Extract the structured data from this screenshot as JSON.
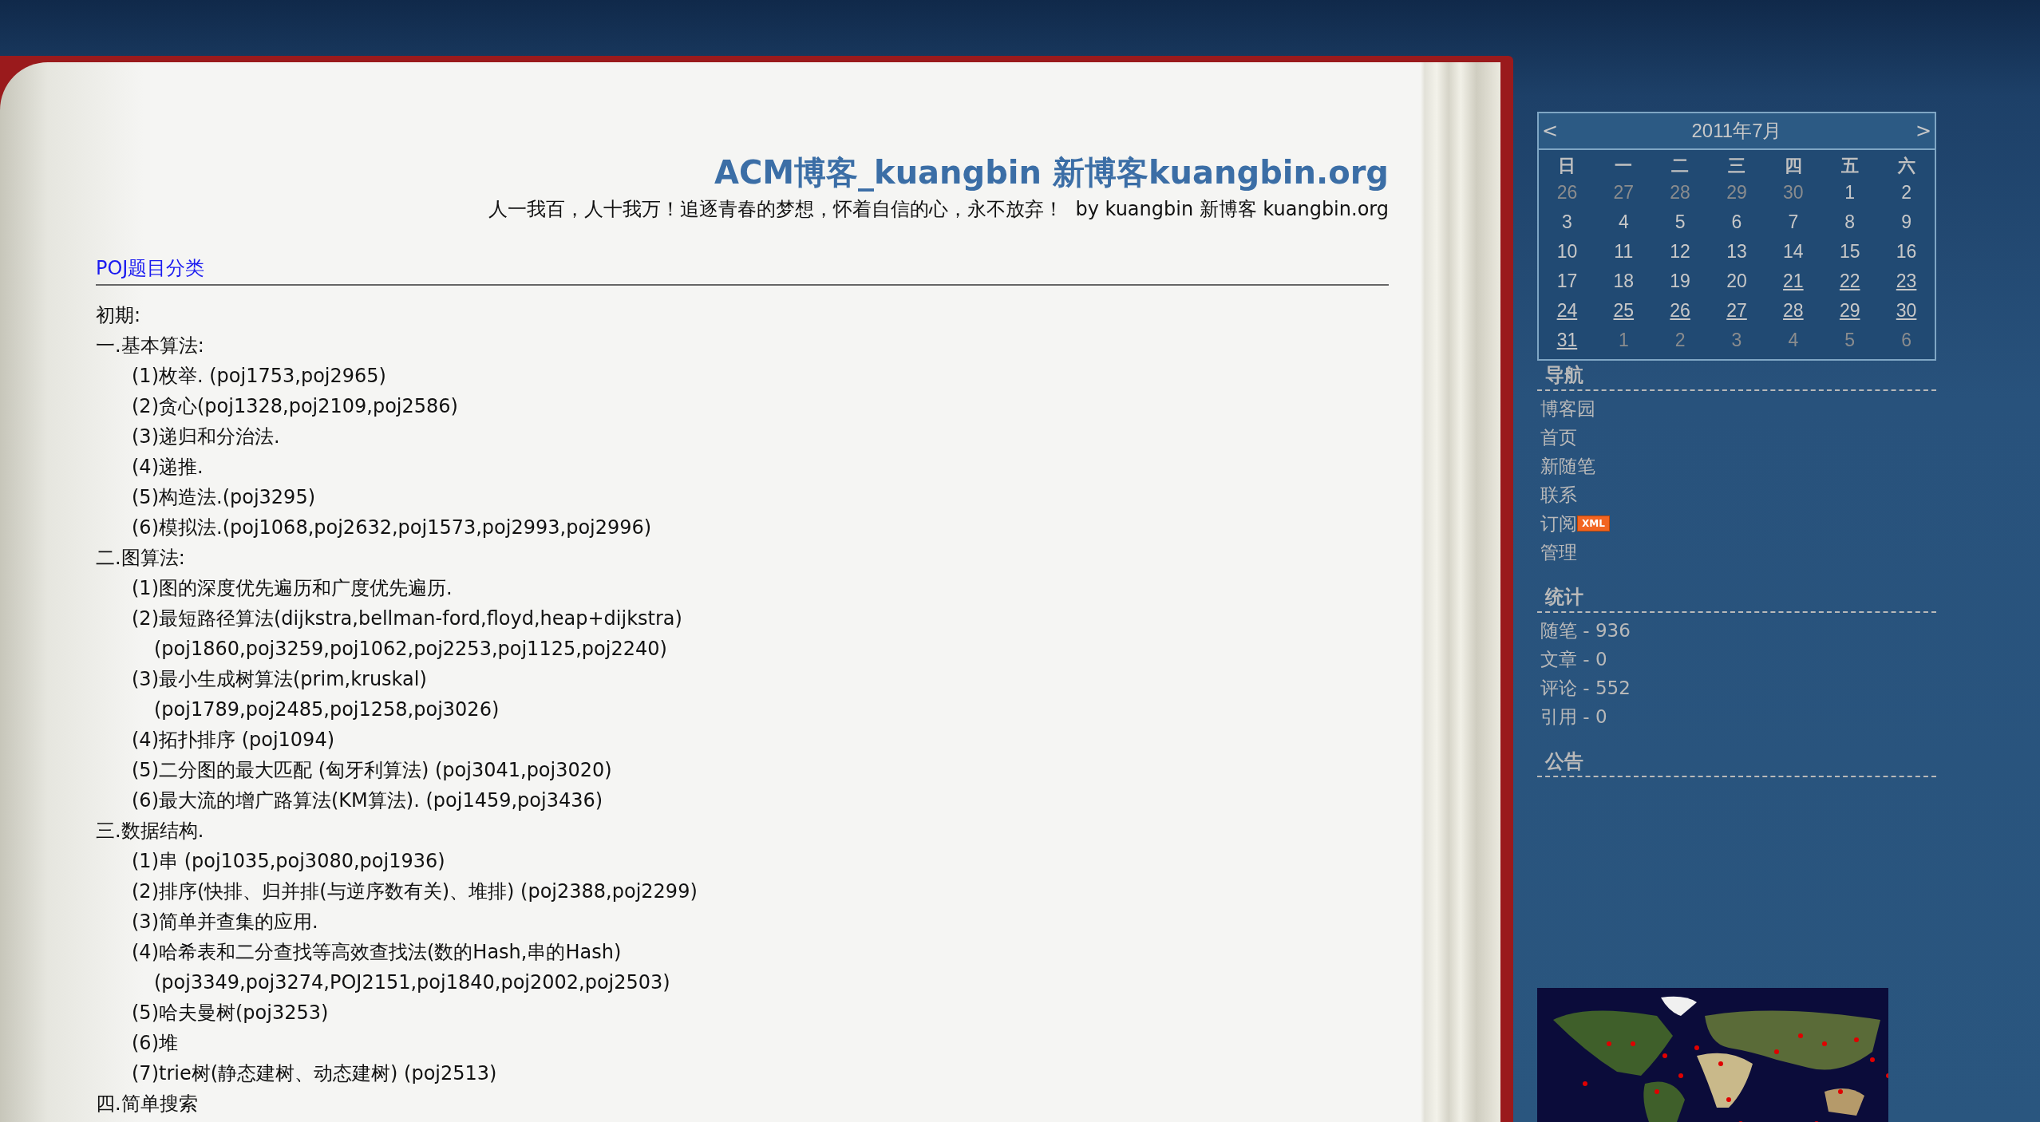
{
  "blog": {
    "title": "ACM博客_kuangbin 新博客kuangbin.org",
    "subtitle": "人一我百，人十我万！追逐青春的梦想，怀着自信的心，永不放弃！  by kuangbin 新博客 kuangbin.org"
  },
  "post": {
    "title": "POJ题目分类",
    "intro": "初期:",
    "categories": [
      {
        "title": "一.基本算法:",
        "children": [
          {
            "text": "(1)枚举. (poj1753,poj2965)"
          },
          {
            "text": "(2)贪心(poj1328,poj2109,poj2586)"
          },
          {
            "text": "(3)递归和分治法."
          },
          {
            "text": "(4)递推."
          },
          {
            "text": "(5)构造法.(poj3295)"
          },
          {
            "text": "(6)模拟法.(poj1068,poj2632,poj1573,poj2993,poj2996)"
          }
        ]
      },
      {
        "title": "二.图算法:",
        "children": [
          {
            "text": "(1)图的深度优先遍历和广度优先遍历."
          },
          {
            "text": "(2)最短路径算法(dijkstra,bellman-ford,floyd,heap+dijkstra)",
            "children": [
              {
                "text": "(poj1860,poj3259,poj1062,poj2253,poj1125,poj2240)"
              }
            ]
          },
          {
            "text": "(3)最小生成树算法(prim,kruskal)",
            "children": [
              {
                "text": "(poj1789,poj2485,poj1258,poj3026)"
              }
            ]
          },
          {
            "text": "(4)拓扑排序 (poj1094)"
          },
          {
            "text": "(5)二分图的最大匹配 (匈牙利算法) (poj3041,poj3020)"
          },
          {
            "text": "(6)最大流的增广路算法(KM算法). (poj1459,poj3436)"
          }
        ]
      },
      {
        "title": "三.数据结构.",
        "children": [
          {
            "text": "(1)串 (poj1035,poj3080,poj1936)"
          },
          {
            "text": "(2)排序(快排、归并排(与逆序数有关)、堆排) (poj2388,poj2299)"
          },
          {
            "text": "(3)简单并查集的应用."
          },
          {
            "text": "(4)哈希表和二分查找等高效查找法(数的Hash,串的Hash)",
            "children": [
              {
                "text": "(poj3349,poj3274,POJ2151,poj1840,poj2002,poj2503)"
              }
            ]
          },
          {
            "text": "(5)哈夫曼树(poj3253)"
          },
          {
            "text": "(6)堆"
          },
          {
            "text": "(7)trie树(静态建树、动态建树) (poj2513)"
          }
        ]
      },
      {
        "title": "四.简单搜索"
      }
    ]
  },
  "calendar": {
    "prev": "<",
    "title": "2011年7月",
    "next": ">",
    "weekdays": [
      "日",
      "一",
      "二",
      "三",
      "四",
      "五",
      "六"
    ],
    "weeks": [
      [
        {
          "day": "26",
          "other_month": true,
          "linked": false
        },
        {
          "day": "27",
          "other_month": true,
          "linked": false
        },
        {
          "day": "28",
          "other_month": true,
          "linked": false
        },
        {
          "day": "29",
          "other_month": true,
          "linked": false
        },
        {
          "day": "30",
          "other_month": true,
          "linked": false
        },
        {
          "day": "1",
          "other_month": false,
          "linked": false
        },
        {
          "day": "2",
          "other_month": false,
          "linked": false
        }
      ],
      [
        {
          "day": "3",
          "other_month": false,
          "linked": false
        },
        {
          "day": "4",
          "other_month": false,
          "linked": false
        },
        {
          "day": "5",
          "other_month": false,
          "linked": false
        },
        {
          "day": "6",
          "other_month": false,
          "linked": false
        },
        {
          "day": "7",
          "other_month": false,
          "linked": false
        },
        {
          "day": "8",
          "other_month": false,
          "linked": false
        },
        {
          "day": "9",
          "other_month": false,
          "linked": false
        }
      ],
      [
        {
          "day": "10",
          "other_month": false,
          "linked": false
        },
        {
          "day": "11",
          "other_month": false,
          "linked": false
        },
        {
          "day": "12",
          "other_month": false,
          "linked": false
        },
        {
          "day": "13",
          "other_month": false,
          "linked": false
        },
        {
          "day": "14",
          "other_month": false,
          "linked": false
        },
        {
          "day": "15",
          "other_month": false,
          "linked": false
        },
        {
          "day": "16",
          "other_month": false,
          "linked": false
        }
      ],
      [
        {
          "day": "17",
          "other_month": false,
          "linked": false
        },
        {
          "day": "18",
          "other_month": false,
          "linked": false
        },
        {
          "day": "19",
          "other_month": false,
          "linked": false
        },
        {
          "day": "20",
          "other_month": false,
          "linked": false
        },
        {
          "day": "21",
          "other_month": false,
          "linked": true
        },
        {
          "day": "22",
          "other_month": false,
          "linked": true
        },
        {
          "day": "23",
          "other_month": false,
          "linked": true
        }
      ],
      [
        {
          "day": "24",
          "other_month": false,
          "linked": true
        },
        {
          "day": "25",
          "other_month": false,
          "linked": true
        },
        {
          "day": "26",
          "other_month": false,
          "linked": true
        },
        {
          "day": "27",
          "other_month": false,
          "linked": true
        },
        {
          "day": "28",
          "other_month": false,
          "linked": true
        },
        {
          "day": "29",
          "other_month": false,
          "linked": true
        },
        {
          "day": "30",
          "other_month": false,
          "linked": true
        }
      ],
      [
        {
          "day": "31",
          "other_month": false,
          "linked": true
        },
        {
          "day": "1",
          "other_month": true,
          "linked": false
        },
        {
          "day": "2",
          "other_month": true,
          "linked": false
        },
        {
          "day": "3",
          "other_month": true,
          "linked": false
        },
        {
          "day": "4",
          "other_month": true,
          "linked": false
        },
        {
          "day": "5",
          "other_month": true,
          "linked": false
        },
        {
          "day": "6",
          "other_month": true,
          "linked": false
        }
      ]
    ]
  },
  "sections": [
    {
      "title": "导航",
      "items": [
        {
          "text": "博客园"
        },
        {
          "text": "首页"
        },
        {
          "text": "新随笔"
        },
        {
          "text": "联系"
        },
        {
          "text": "订阅",
          "badge": "XML"
        },
        {
          "text": "管理"
        }
      ]
    },
    {
      "title": "统计",
      "items": [
        {
          "text": "随笔 - 936"
        },
        {
          "text": "文章 - 0"
        },
        {
          "text": "评论 - 552"
        },
        {
          "text": "引用 - 0"
        }
      ]
    },
    {
      "title": "公告"
    }
  ]
}
